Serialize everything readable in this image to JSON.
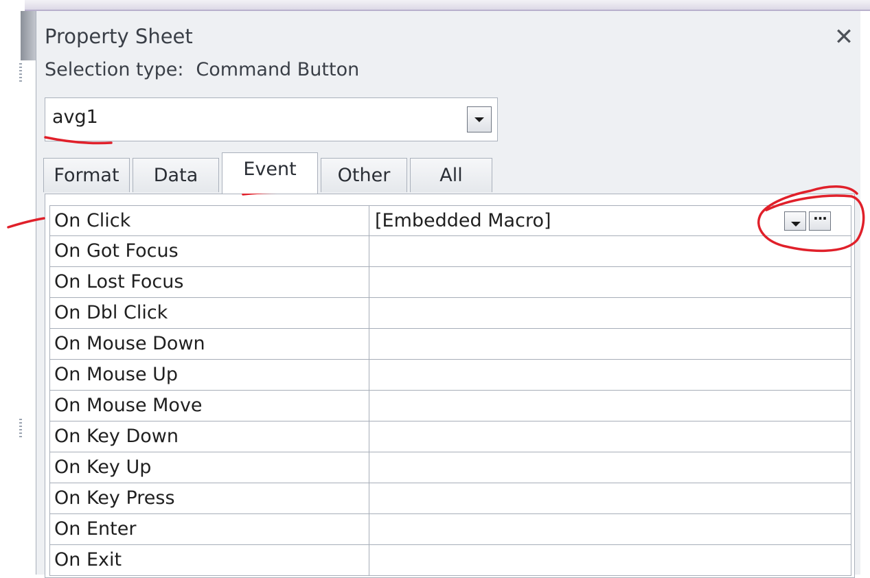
{
  "pane": {
    "title": "Property Sheet",
    "close_label": "✕",
    "selection_type_label": "Selection type:",
    "selection_type_value": "Command Button"
  },
  "object_selector": {
    "value": "avg1",
    "dropdown_icon": "chevron-down-icon"
  },
  "tabs": [
    {
      "label": "Format",
      "active": false
    },
    {
      "label": "Data",
      "active": false
    },
    {
      "label": "Event",
      "active": true
    },
    {
      "label": "Other",
      "active": false
    },
    {
      "label": "All",
      "active": false
    }
  ],
  "properties": [
    {
      "name": "On Click",
      "value": "[Embedded Macro]"
    },
    {
      "name": "On Got Focus",
      "value": ""
    },
    {
      "name": "On Lost Focus",
      "value": ""
    },
    {
      "name": "On Dbl Click",
      "value": ""
    },
    {
      "name": "On Mouse Down",
      "value": ""
    },
    {
      "name": "On Mouse Up",
      "value": ""
    },
    {
      "name": "On Mouse Move",
      "value": ""
    },
    {
      "name": "On Key Down",
      "value": ""
    },
    {
      "name": "On Key Up",
      "value": ""
    },
    {
      "name": "On Key Press",
      "value": ""
    },
    {
      "name": "On Enter",
      "value": ""
    },
    {
      "name": "On Exit",
      "value": ""
    }
  ],
  "property_buttons": {
    "dropdown_icon": "chevron-down-icon",
    "builder_label": "···"
  },
  "annotation_color": "#e0202a"
}
